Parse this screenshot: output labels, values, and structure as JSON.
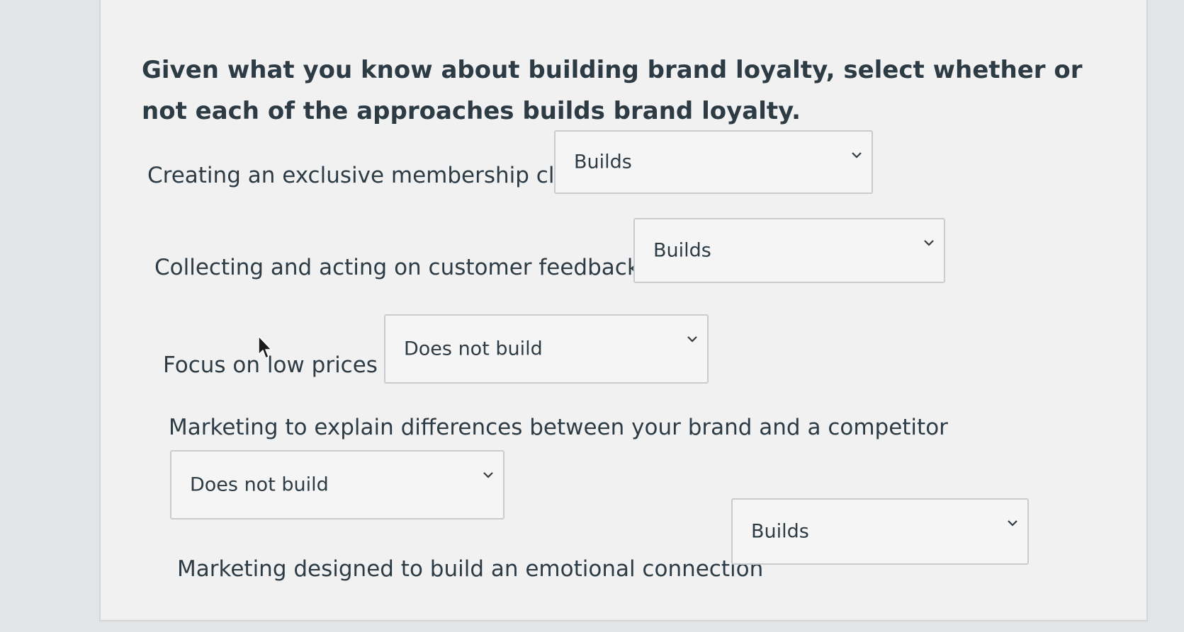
{
  "question": {
    "prompt": "Given what you know about building brand loyalty, select whether or not each of the approaches builds brand loyalty."
  },
  "rows": [
    {
      "label": "Creating an exclusive membership club",
      "selected": "Builds"
    },
    {
      "label": "Collecting and acting on customer feedback",
      "selected": "Builds"
    },
    {
      "label": "Focus on low prices",
      "selected": "Does not build"
    },
    {
      "label": "Marketing to explain differences between your brand and a competitor",
      "selected": "Does not build"
    },
    {
      "label": "Marketing designed to build an emotional connection",
      "selected": "Builds"
    }
  ],
  "icons": {
    "dropdown": "chevron-down-icon",
    "pointer": "mouse-cursor-icon"
  }
}
